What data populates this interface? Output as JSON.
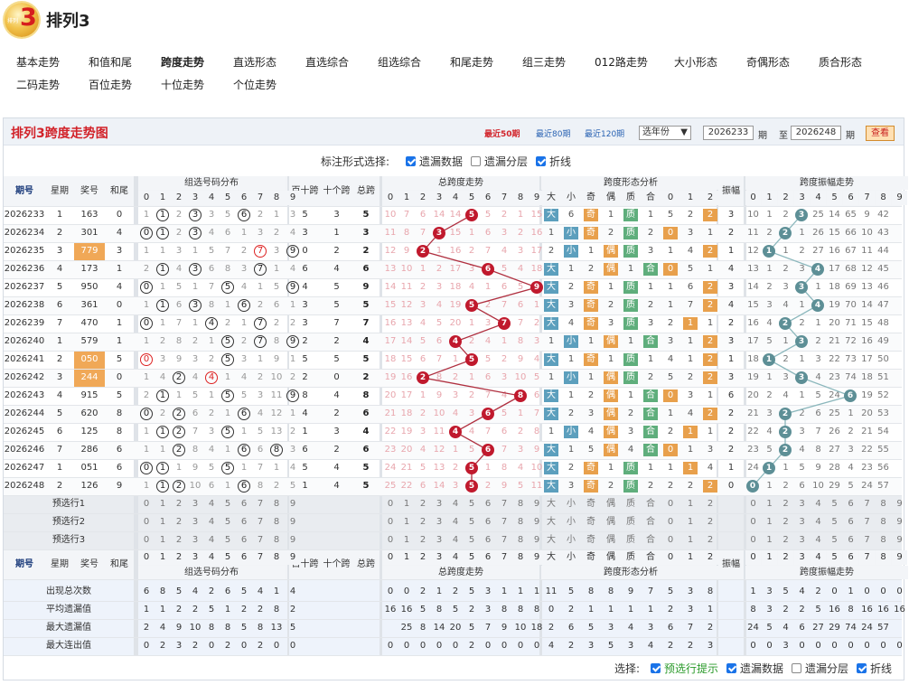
{
  "header": {
    "logo_text": "排列",
    "logo_num": "3",
    "title": "排列3"
  },
  "nav": [
    "基本走势",
    "和值和尾",
    "跨度走势",
    "直选形态",
    "直选综合",
    "组选综合",
    "和尾走势",
    "组三走势",
    "012路走势",
    "大小形态",
    "奇偶形态",
    "质合形态",
    "二码走势",
    "百位走势",
    "十位走势",
    "个位走势"
  ],
  "nav_active": 2,
  "card": {
    "title": "排列3跨度走势图",
    "ranges": [
      "最近50期",
      "最近80期",
      "最近120期"
    ],
    "year_select": "选年份",
    "from": "2026233",
    "to": "2026248",
    "period": "期",
    "to_label": "至",
    "search": "查看"
  },
  "top_opts": {
    "label": "标注形式选择:",
    "items": [
      {
        "t": "遗漏数据",
        "on": true
      },
      {
        "t": "遗漏分层",
        "on": false
      },
      {
        "t": "折线",
        "on": true
      }
    ]
  },
  "bottom_opts": {
    "label": "选择:",
    "items": [
      {
        "t": "预选行提示",
        "on": true,
        "green": true
      },
      {
        "t": "遗漏数据",
        "on": true
      },
      {
        "t": "遗漏分层",
        "on": false
      },
      {
        "t": "折线",
        "on": true
      }
    ]
  },
  "headers": {
    "qihao": "期号",
    "xingqi": "星期",
    "jianghao": "奖号",
    "hewei": "和尾",
    "zuxuan": "组选号码分布",
    "bs": "百十跨",
    "sg": "十个跨",
    "zk": "总跨",
    "zkzs": "总跨度走势",
    "xt": "跨度形态分析",
    "zf": "振幅",
    "zfzs": "跨度振幅走势",
    "xt_cols": [
      "大",
      "小",
      "奇",
      "偶",
      "质",
      "合",
      "0",
      "1",
      "2"
    ],
    "digits": [
      "0",
      "1",
      "2",
      "3",
      "4",
      "5",
      "6",
      "7",
      "8",
      "9"
    ]
  },
  "colors": {
    "red_ball": "#c0192d",
    "teal_ball": "#5d8f96",
    "line_red": "#b03040",
    "line_teal": "#8bb7bc",
    "hl": "#f0a857",
    "sq_blue": "#5c9fbd",
    "sq_green": "#5fae7c",
    "sq_orange": "#e8a04c"
  },
  "rows": [
    {
      "q": "2026233",
      "x": "1",
      "j": "163",
      "h": "0",
      "zx": [
        1,
        "1",
        2,
        "3",
        3,
        5,
        "6",
        2,
        1,
        3
      ],
      "bs": "5",
      "sg": "3",
      "zk": "5",
      "kd": [
        10,
        7,
        6,
        14,
        14,
        "5",
        5,
        2,
        1,
        15
      ],
      "xt": [
        "大",
        6,
        "奇",
        1,
        "质",
        1,
        5,
        2,
        "2"
      ],
      "zf": "3",
      "zfz": [
        10,
        1,
        2,
        "3",
        25,
        14,
        65,
        9,
        42,
        ""
      ]
    },
    {
      "q": "2026234",
      "x": "2",
      "j": "301",
      "h": "4",
      "zx": [
        "0",
        "1",
        2,
        "3",
        4,
        6,
        1,
        3,
        2,
        4
      ],
      "bs": "3",
      "sg": "1",
      "zk": "3",
      "kd": [
        11,
        8,
        7,
        "3",
        15,
        1,
        6,
        3,
        2,
        16
      ],
      "xt": [
        1,
        "小",
        "奇",
        2,
        "质",
        2,
        "0",
        3,
        1
      ],
      "zf": "2",
      "zfz": [
        11,
        2,
        "2",
        1,
        26,
        15,
        66,
        10,
        43,
        ""
      ]
    },
    {
      "q": "2026235",
      "x": "3",
      "j": "779",
      "h": "3",
      "hl": true,
      "zx": [
        1,
        1,
        3,
        1,
        5,
        7,
        2,
        "7!",
        3,
        "9"
      ],
      "bs": "0",
      "sg": "2",
      "zk": "2",
      "kd": [
        12,
        9,
        "2",
        1,
        16,
        2,
        7,
        4,
        3,
        17
      ],
      "xt": [
        2,
        "小",
        1,
        "偶",
        "质",
        3,
        1,
        4,
        "2"
      ],
      "zf": "1",
      "zfz": [
        12,
        "1",
        1,
        2,
        27,
        16,
        67,
        11,
        44,
        ""
      ]
    },
    {
      "q": "2026236",
      "x": "4",
      "j": "173",
      "h": "1",
      "zx": [
        2,
        "1",
        4,
        "3",
        6,
        8,
        3,
        "7",
        1,
        4
      ],
      "bs": "6",
      "sg": "4",
      "zk": "6",
      "kd": [
        13,
        10,
        1,
        2,
        17,
        3,
        "6",
        5,
        4,
        18
      ],
      "xt": [
        "大",
        1,
        2,
        "偶",
        1,
        "合",
        "0",
        5,
        1
      ],
      "zf": "4",
      "zfz": [
        13,
        1,
        2,
        3,
        "4",
        17,
        68,
        12,
        45,
        ""
      ]
    },
    {
      "q": "2026237",
      "x": "5",
      "j": "950",
      "h": "4",
      "zx": [
        "0",
        1,
        5,
        1,
        7,
        "5",
        4,
        1,
        5,
        "9"
      ],
      "bs": "4",
      "sg": "5",
      "zk": "9",
      "kd": [
        14,
        11,
        2,
        3,
        18,
        4,
        1,
        6,
        5,
        "9"
      ],
      "xt": [
        "大",
        2,
        "奇",
        1,
        "质",
        1,
        1,
        6,
        "2"
      ],
      "zf": "3",
      "zfz": [
        14,
        2,
        3,
        "3",
        1,
        18,
        69,
        13,
        46,
        ""
      ]
    },
    {
      "q": "2026238",
      "x": "6",
      "j": "361",
      "h": "0",
      "zx": [
        1,
        "1",
        6,
        "3",
        8,
        1,
        "6",
        2,
        6,
        1
      ],
      "bs": "3",
      "sg": "5",
      "zk": "5",
      "kd": [
        15,
        12,
        3,
        4,
        19,
        "5",
        2,
        7,
        6,
        1
      ],
      "xt": [
        "大",
        3,
        "奇",
        2,
        "质",
        2,
        1,
        7,
        "2"
      ],
      "zf": "4",
      "zfz": [
        15,
        3,
        4,
        1,
        "4",
        19,
        70,
        14,
        47,
        ""
      ]
    },
    {
      "q": "2026239",
      "x": "7",
      "j": "470",
      "h": "1",
      "zx": [
        "0",
        1,
        7,
        1,
        "4",
        2,
        1,
        "7",
        2,
        2
      ],
      "bs": "3",
      "sg": "7",
      "zk": "7",
      "kd": [
        16,
        13,
        4,
        5,
        20,
        1,
        3,
        "7",
        7,
        2
      ],
      "xt": [
        "大",
        4,
        "奇",
        3,
        "质",
        3,
        2,
        "1",
        1
      ],
      "zf": "2",
      "zfz": [
        16,
        4,
        "2",
        2,
        1,
        20,
        71,
        15,
        48,
        ""
      ]
    },
    {
      "q": "2026240",
      "x": "1",
      "j": "579",
      "h": "1",
      "zx": [
        1,
        2,
        8,
        2,
        1,
        "5",
        2,
        "7",
        8,
        "9"
      ],
      "bs": "2",
      "sg": "2",
      "zk": "4",
      "kd": [
        17,
        14,
        5,
        6,
        "4",
        2,
        4,
        1,
        8,
        3
      ],
      "xt": [
        1,
        "小",
        1,
        "偶",
        1,
        "合",
        3,
        1,
        "2"
      ],
      "zf": "3",
      "zfz": [
        17,
        5,
        1,
        "3",
        2,
        21,
        72,
        16,
        49,
        ""
      ]
    },
    {
      "q": "2026241",
      "x": "2",
      "j": "050",
      "h": "5",
      "hl": true,
      "zx": [
        "0!",
        3,
        9,
        3,
        2,
        "5",
        3,
        1,
        9,
        1
      ],
      "bs": "5",
      "sg": "5",
      "zk": "5",
      "kd": [
        18,
        15,
        6,
        7,
        1,
        "5",
        5,
        2,
        9,
        4
      ],
      "xt": [
        "大",
        1,
        "奇",
        1,
        "质",
        1,
        4,
        1,
        "2"
      ],
      "zf": "1",
      "zfz": [
        18,
        "1",
        2,
        1,
        3,
        22,
        73,
        17,
        50,
        ""
      ]
    },
    {
      "q": "2026242",
      "x": "3",
      "j": "244",
      "h": "0",
      "hl": true,
      "zx": [
        1,
        4,
        "2",
        4,
        "4!",
        1,
        4,
        2,
        10,
        2
      ],
      "bs": "2",
      "sg": "0",
      "zk": "2",
      "kd": [
        19,
        16,
        "2",
        8,
        2,
        1,
        6,
        3,
        10,
        5
      ],
      "xt": [
        1,
        "小",
        1,
        "偶",
        "质",
        2,
        5,
        2,
        "2"
      ],
      "zf": "3",
      "zfz": [
        19,
        1,
        3,
        "3",
        4,
        23,
        74,
        18,
        51,
        ""
      ]
    },
    {
      "q": "2026243",
      "x": "4",
      "j": "915",
      "h": "5",
      "zx": [
        2,
        "1",
        1,
        5,
        1,
        "5",
        5,
        3,
        11,
        "9"
      ],
      "bs": "8",
      "sg": "4",
      "zk": "8",
      "kd": [
        20,
        17,
        1,
        9,
        3,
        2,
        7,
        4,
        "8",
        6
      ],
      "xt": [
        "大",
        1,
        2,
        "偶",
        1,
        "合",
        "0",
        3,
        1
      ],
      "zf": "6",
      "zfz": [
        20,
        2,
        4,
        1,
        5,
        24,
        "6",
        19,
        52,
        ""
      ]
    },
    {
      "q": "2026244",
      "x": "5",
      "j": "620",
      "h": "8",
      "zx": [
        "0",
        2,
        "2",
        6,
        2,
        1,
        "6",
        4,
        12,
        1
      ],
      "bs": "4",
      "sg": "2",
      "zk": "6",
      "kd": [
        21,
        18,
        2,
        10,
        4,
        3,
        "6",
        5,
        1,
        7
      ],
      "xt": [
        "大",
        2,
        3,
        "偶",
        2,
        "合",
        1,
        4,
        "2"
      ],
      "zf": "2",
      "zfz": [
        21,
        3,
        "2",
        2,
        6,
        25,
        1,
        20,
        53,
        ""
      ]
    },
    {
      "q": "2026245",
      "x": "6",
      "j": "125",
      "h": "8",
      "zx": [
        1,
        "1",
        "2",
        7,
        3,
        "5",
        1,
        5,
        13,
        2
      ],
      "bs": "1",
      "sg": "3",
      "zk": "4",
      "kd": [
        22,
        19,
        3,
        11,
        "4",
        4,
        7,
        6,
        2,
        8
      ],
      "xt": [
        1,
        "小",
        4,
        "偶",
        3,
        "合",
        2,
        "1",
        1
      ],
      "zf": "2",
      "zfz": [
        22,
        4,
        "2",
        3,
        7,
        26,
        2,
        21,
        54,
        ""
      ]
    },
    {
      "q": "2026246",
      "x": "7",
      "j": "286",
      "h": "6",
      "zx": [
        1,
        1,
        "2",
        8,
        4,
        1,
        "6",
        6,
        "8",
        3
      ],
      "bs": "6",
      "sg": "2",
      "zk": "6",
      "kd": [
        23,
        20,
        4,
        12,
        1,
        5,
        "6",
        7,
        3,
        9
      ],
      "xt": [
        "大",
        1,
        5,
        "偶",
        4,
        "合",
        "0",
        1,
        3
      ],
      "zf": "2",
      "zfz": [
        23,
        5,
        "2",
        4,
        8,
        27,
        3,
        22,
        55,
        ""
      ]
    },
    {
      "q": "2026247",
      "x": "1",
      "j": "051",
      "h": "6",
      "zx": [
        "0",
        "1",
        1,
        9,
        5,
        "5",
        1,
        7,
        1,
        4
      ],
      "bs": "5",
      "sg": "4",
      "zk": "5",
      "kd": [
        24,
        21,
        5,
        13,
        2,
        "5",
        1,
        8,
        4,
        10
      ],
      "xt": [
        "大",
        2,
        "奇",
        1,
        "质",
        1,
        1,
        "1",
        4
      ],
      "zf": "1",
      "zfz": [
        24,
        "1",
        1,
        5,
        9,
        28,
        4,
        23,
        56,
        ""
      ]
    },
    {
      "q": "2026248",
      "x": "2",
      "j": "126",
      "h": "9",
      "zx": [
        1,
        "1",
        "2",
        10,
        6,
        1,
        "6",
        8,
        2,
        5
      ],
      "bs": "1",
      "sg": "4",
      "zk": "5",
      "kd": [
        25,
        22,
        6,
        14,
        3,
        "5",
        2,
        9,
        5,
        11
      ],
      "xt": [
        "大",
        3,
        "奇",
        2,
        "质",
        2,
        2,
        2,
        "2"
      ],
      "zf": "0",
      "zfz": [
        "0",
        1,
        2,
        6,
        10,
        29,
        5,
        24,
        57,
        ""
      ]
    }
  ],
  "pre_rows": [
    "预选行1",
    "预选行2",
    "预选行3"
  ],
  "stats": {
    "labels": [
      "出现总次数",
      "平均遗漏值",
      "最大遗漏值",
      "最大连出值"
    ],
    "zx": [
      [
        6,
        8,
        5,
        4,
        2,
        6,
        5,
        4,
        1,
        4
      ],
      [
        1,
        1,
        2,
        2,
        5,
        1,
        2,
        2,
        8,
        2
      ],
      [
        2,
        4,
        9,
        10,
        8,
        8,
        5,
        8,
        13,
        5
      ],
      [
        0,
        2,
        3,
        2,
        0,
        2,
        0,
        2,
        0,
        0
      ]
    ],
    "kd": [
      [
        0,
        0,
        2,
        1,
        2,
        5,
        3,
        1,
        1,
        1
      ],
      [
        16,
        16,
        5,
        8,
        5,
        2,
        3,
        8,
        8,
        8
      ],
      [
        "",
        25,
        8,
        14,
        20,
        5,
        7,
        9,
        10,
        18
      ],
      [
        0,
        0,
        0,
        0,
        0,
        2,
        0,
        0,
        0,
        0
      ]
    ],
    "xt": [
      [
        11,
        5,
        8,
        8,
        9,
        7,
        5,
        3,
        8
      ],
      [
        0,
        2,
        1,
        1,
        1,
        1,
        2,
        3,
        1
      ],
      [
        2,
        6,
        5,
        3,
        4,
        3,
        6,
        7,
        2
      ],
      [
        4,
        2,
        3,
        5,
        3,
        4,
        2,
        2,
        3
      ]
    ],
    "zfz": [
      [
        1,
        3,
        5,
        4,
        2,
        0,
        1,
        0,
        0,
        0
      ],
      [
        8,
        3,
        2,
        2,
        5,
        16,
        8,
        16,
        16,
        16
      ],
      [
        24,
        5,
        4,
        6,
        27,
        29,
        74,
        24,
        57,
        ""
      ],
      [
        0,
        0,
        3,
        0,
        0,
        0,
        0,
        0,
        0,
        0
      ]
    ]
  }
}
